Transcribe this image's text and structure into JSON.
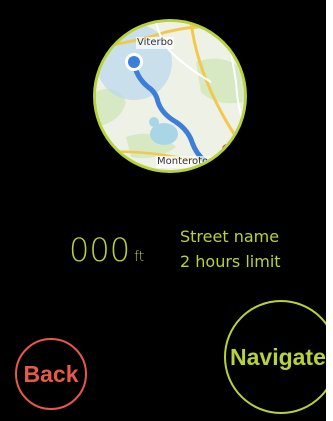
{
  "map": {
    "town_top": "Viterbo",
    "town_bottom": "Monterotondo",
    "route_color": "#3d7fd6",
    "water_color": "#a9d6e6",
    "green_color": "#d6e9c2",
    "road_color": "#f2c94c",
    "pin_color": "#e23b3b",
    "ring_color": "#b7d23a"
  },
  "distance": {
    "value": "000",
    "unit": "ft"
  },
  "info": {
    "street": "Street name",
    "limit": "2 hours limit"
  },
  "buttons": {
    "back_label": "Back",
    "navigate_label": "Navigate"
  },
  "colors": {
    "background": "#000000",
    "accent": "#b7d23a",
    "danger": "#e8584b"
  }
}
